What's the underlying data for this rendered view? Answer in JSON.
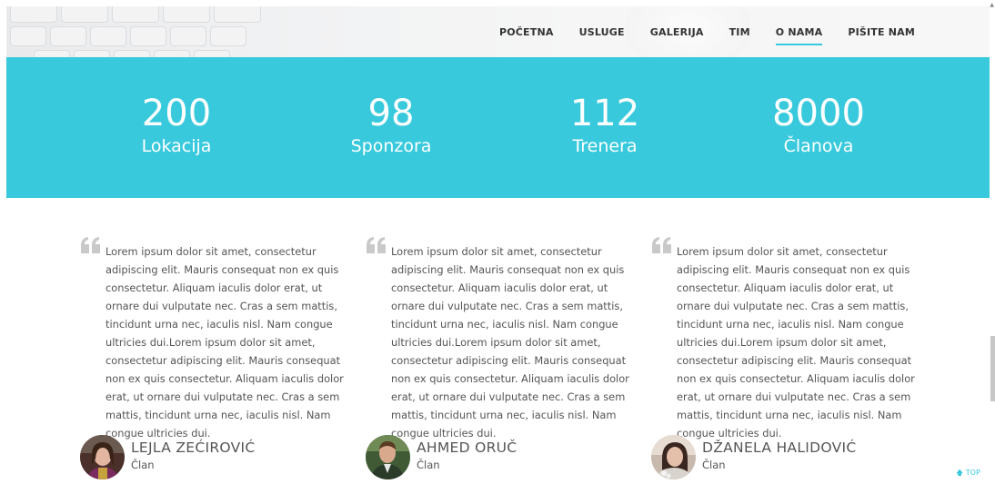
{
  "nav": {
    "items": [
      {
        "label": "POČETNA",
        "active": false
      },
      {
        "label": "USLUGE",
        "active": false
      },
      {
        "label": "GALERIJA",
        "active": false
      },
      {
        "label": "TIM",
        "active": false
      },
      {
        "label": "O NAMA",
        "active": true
      },
      {
        "label": "PIŠITE NAM",
        "active": false
      }
    ]
  },
  "stats": [
    {
      "number": "200",
      "label": "Lokacija"
    },
    {
      "number": "98",
      "label": "Sponzora"
    },
    {
      "number": "112",
      "label": "Trenera"
    },
    {
      "number": "8000",
      "label": "Članova"
    }
  ],
  "testimonials": [
    {
      "text": "Lorem ipsum dolor sit amet, consectetur adipiscing elit. Mauris consequat non ex quis consectetur. Aliquam iaculis dolor erat, ut ornare dui vulputate nec. Cras a sem mattis, tincidunt urna nec, iaculis nisl. Nam congue ultricies dui.Lorem ipsum dolor sit amet, consectetur adipiscing elit. Mauris consequat non ex quis consectetur. Aliquam iaculis dolor erat, ut ornare dui vulputate nec. Cras a sem mattis, tincidunt urna nec, iaculis nisl. Nam congue ultricies dui.",
      "name": "LEJLA ZEĆIROVIĆ",
      "role": "Član"
    },
    {
      "text": "Lorem ipsum dolor sit amet, consectetur adipiscing elit. Mauris consequat non ex quis consectetur. Aliquam iaculis dolor erat, ut ornare dui vulputate nec. Cras a sem mattis, tincidunt urna nec, iaculis nisl. Nam congue ultricies dui.Lorem ipsum dolor sit amet, consectetur adipiscing elit. Mauris consequat non ex quis consectetur. Aliquam iaculis dolor erat, ut ornare dui vulputate nec. Cras a sem mattis, tincidunt urna nec, iaculis nisl. Nam congue ultricies dui.",
      "name": "AHMED ORUČ",
      "role": "Član"
    },
    {
      "text": "Lorem ipsum dolor sit amet, consectetur adipiscing elit. Mauris consequat non ex quis consectetur. Aliquam iaculis dolor erat, ut ornare dui vulputate nec. Cras a sem mattis, tincidunt urna nec, iaculis nisl. Nam congue ultricies dui.Lorem ipsum dolor sit amet, consectetur adipiscing elit. Mauris consequat non ex quis consectetur. Aliquam iaculis dolor erat, ut ornare dui vulputate nec. Cras a sem mattis, tincidunt urna nec, iaculis nisl. Nam congue ultricies dui.",
      "name": "DŽANELA HALIDOVIĆ",
      "role": "Član"
    }
  ],
  "top_link": {
    "icon": "arrow-up-icon",
    "label": "TOP"
  },
  "colors": {
    "accent": "#38c9dd",
    "text": "#555555",
    "nav_text": "#333333"
  }
}
